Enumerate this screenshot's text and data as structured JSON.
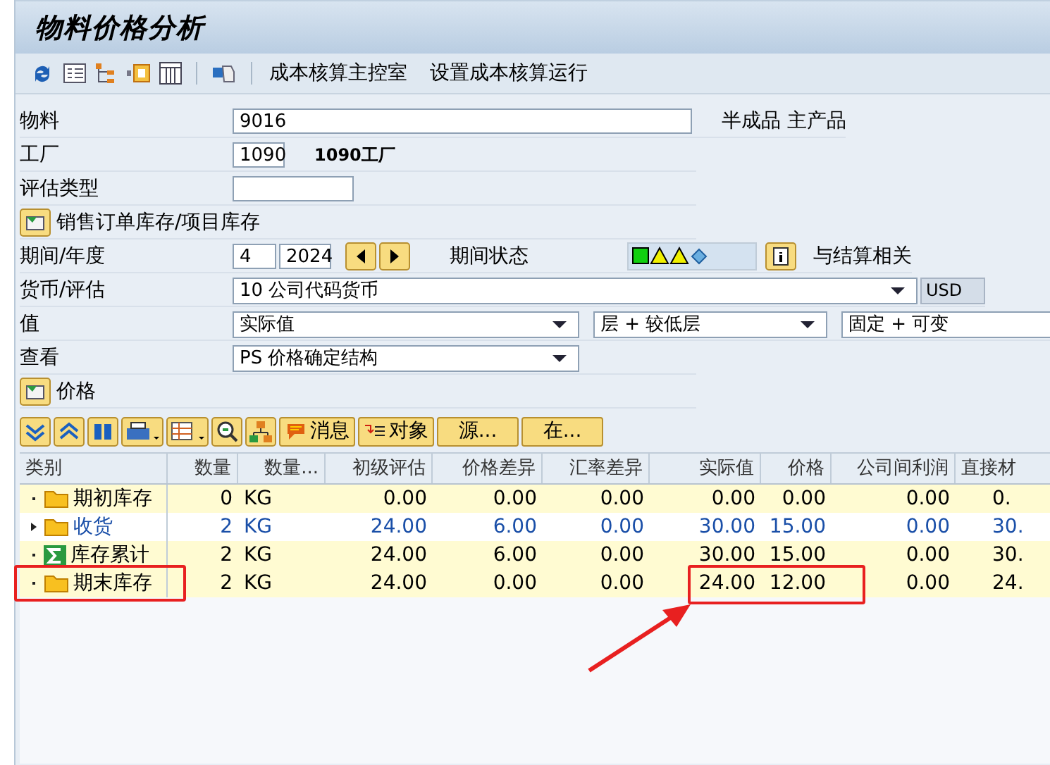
{
  "window": {
    "title": "物料价格分析"
  },
  "toolbar": {
    "buttons": [
      "成本核算主控室",
      "设置成本核算运行"
    ]
  },
  "material": {
    "label": "物料",
    "value": "9016",
    "description": "半成品 主产品"
  },
  "plant": {
    "label": "工厂",
    "value": "1090",
    "description": "1090工厂"
  },
  "valuation_type": {
    "label": "评估类型"
  },
  "sales_order_button": "销售订单库存/项目库存",
  "period": {
    "label": "期间/年度",
    "period": "4",
    "year": "2024",
    "status_label": "期间状态",
    "settlement_label": "与结算相关"
  },
  "currency": {
    "label": "货币/评估",
    "value": "10 公司代码货币",
    "unit": "USD"
  },
  "values": {
    "label": "值",
    "value": "实际值",
    "levels": "层 + 较低层",
    "components": "固定 + 可变"
  },
  "view": {
    "label": "查看",
    "value": "PS 价格确定结构"
  },
  "price_button": "价格",
  "grid_buttons": [
    "消息",
    "对象",
    "源...",
    "在..."
  ],
  "table": {
    "columns": [
      "类别",
      "数量",
      "数量...",
      "初级评估",
      "价格差异",
      "汇率差异",
      "实际值",
      "价格",
      "公司间利润",
      "直接材"
    ],
    "rows": [
      {
        "kind": "folder",
        "expandable": false,
        "selected": false,
        "cells": [
          "期初库存",
          "0",
          "KG",
          "0.00",
          "0.00",
          "0.00",
          "0.00",
          "0.00",
          "0.00",
          "0."
        ]
      },
      {
        "kind": "folder",
        "expandable": true,
        "selected": true,
        "cells": [
          "收货",
          "2",
          "KG",
          "24.00",
          "6.00",
          "0.00",
          "30.00",
          "15.00",
          "0.00",
          "30."
        ]
      },
      {
        "kind": "sum",
        "expandable": false,
        "selected": false,
        "cells": [
          "库存累计",
          "2",
          "KG",
          "24.00",
          "6.00",
          "0.00",
          "30.00",
          "15.00",
          "0.00",
          "30."
        ]
      },
      {
        "kind": "folder",
        "expandable": false,
        "selected": false,
        "cells": [
          "期末库存",
          "2",
          "KG",
          "24.00",
          "0.00",
          "0.00",
          "24.00",
          "12.00",
          "0.00",
          "24."
        ]
      }
    ]
  }
}
